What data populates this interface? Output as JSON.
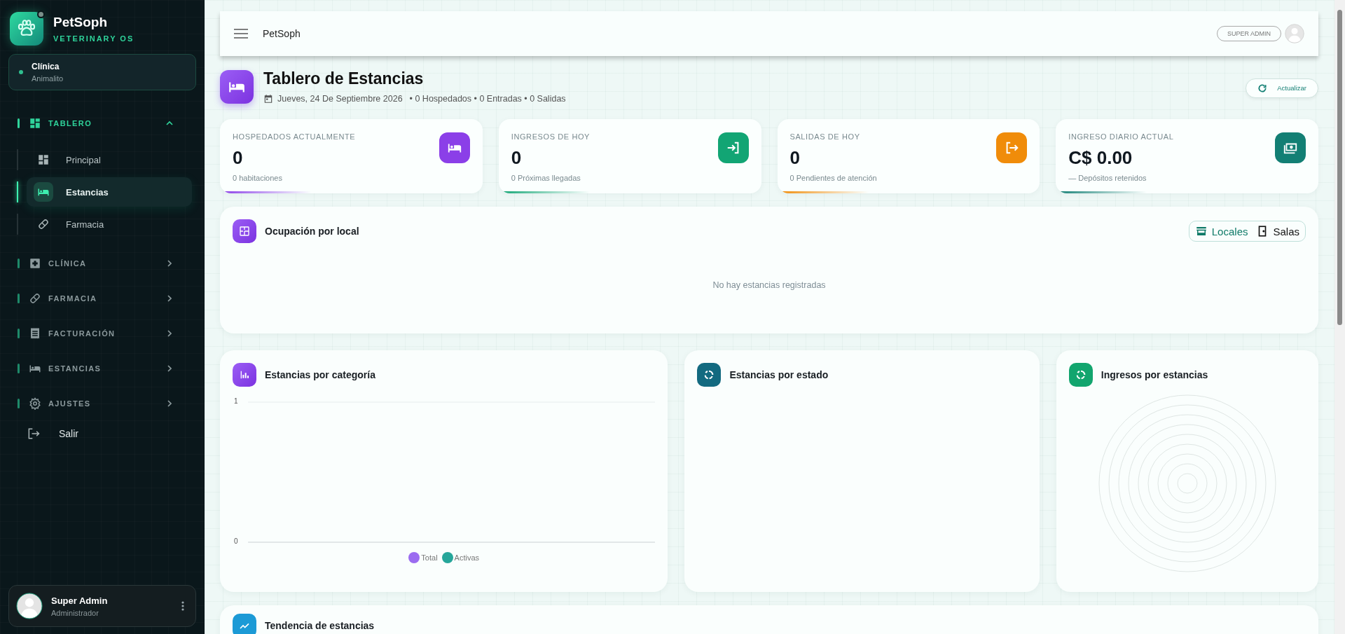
{
  "brand": {
    "name": "PetSoph",
    "tagline": "VETERINARY OS"
  },
  "clinic": {
    "label": "Clínica",
    "name": "Animalito"
  },
  "nav": [
    {
      "label": "TABLERO",
      "expanded": true,
      "children": [
        {
          "label": "Principal",
          "selected": false
        },
        {
          "label": "Estancias",
          "selected": true
        },
        {
          "label": "Farmacia",
          "selected": false
        }
      ]
    },
    {
      "label": "CLÍNICA",
      "expanded": false
    },
    {
      "label": "FARMACIA",
      "expanded": false
    },
    {
      "label": "FACTURACIÓN",
      "expanded": false
    },
    {
      "label": "ESTANCIAS",
      "expanded": false
    },
    {
      "label": "AJUSTES",
      "expanded": false
    }
  ],
  "logout": "Salir",
  "user": {
    "name": "Super Admin",
    "role": "Administrador"
  },
  "topbar": {
    "title": "PetSoph",
    "role_badge": "SUPER ADMIN"
  },
  "page": {
    "title": "Tablero de Estancias",
    "date": "Jueves, 24 De Septiembre 2026",
    "summary": "• 0 Hospedados • 0 Entradas • 0 Salidas",
    "refresh": "Actualizar"
  },
  "stats": [
    {
      "label": "HOSPEDADOS ACTUALMENTE",
      "value": "0",
      "sub": "0 habitaciones",
      "color": "#8b3fe8"
    },
    {
      "label": "INGRESOS DE HOY",
      "value": "0",
      "sub": "0 Próximas llegadas",
      "color": "#12a574"
    },
    {
      "label": "SALIDAS DE HOY",
      "value": "0",
      "sub": "0 Pendientes de atención",
      "color": "#f08c0a"
    },
    {
      "label": "INGRESO DIARIO ACTUAL",
      "value": "C$ 0.00",
      "sub": "— Depósitos retenidos",
      "color": "#137f74"
    }
  ],
  "occupancy": {
    "title": "Ocupación por local",
    "toggle": [
      {
        "label": "Locales",
        "selected": true
      },
      {
        "label": "Salas",
        "selected": false
      }
    ],
    "empty": "No hay estancias registradas"
  },
  "category_chart": {
    "title": "Estancias por categoría",
    "chart_data": {
      "type": "bar",
      "ylim": [
        0,
        1
      ],
      "yticks": [
        0,
        1
      ],
      "series": [
        {
          "name": "Total",
          "color": "#9b6cf0"
        },
        {
          "name": "Activas",
          "color": "#26a69a"
        }
      ]
    }
  },
  "status_chart": {
    "title": "Estancias por estado"
  },
  "income_chart": {
    "title": "Ingresos por estancias"
  },
  "trend": {
    "title": "Tendencia de estancias"
  }
}
